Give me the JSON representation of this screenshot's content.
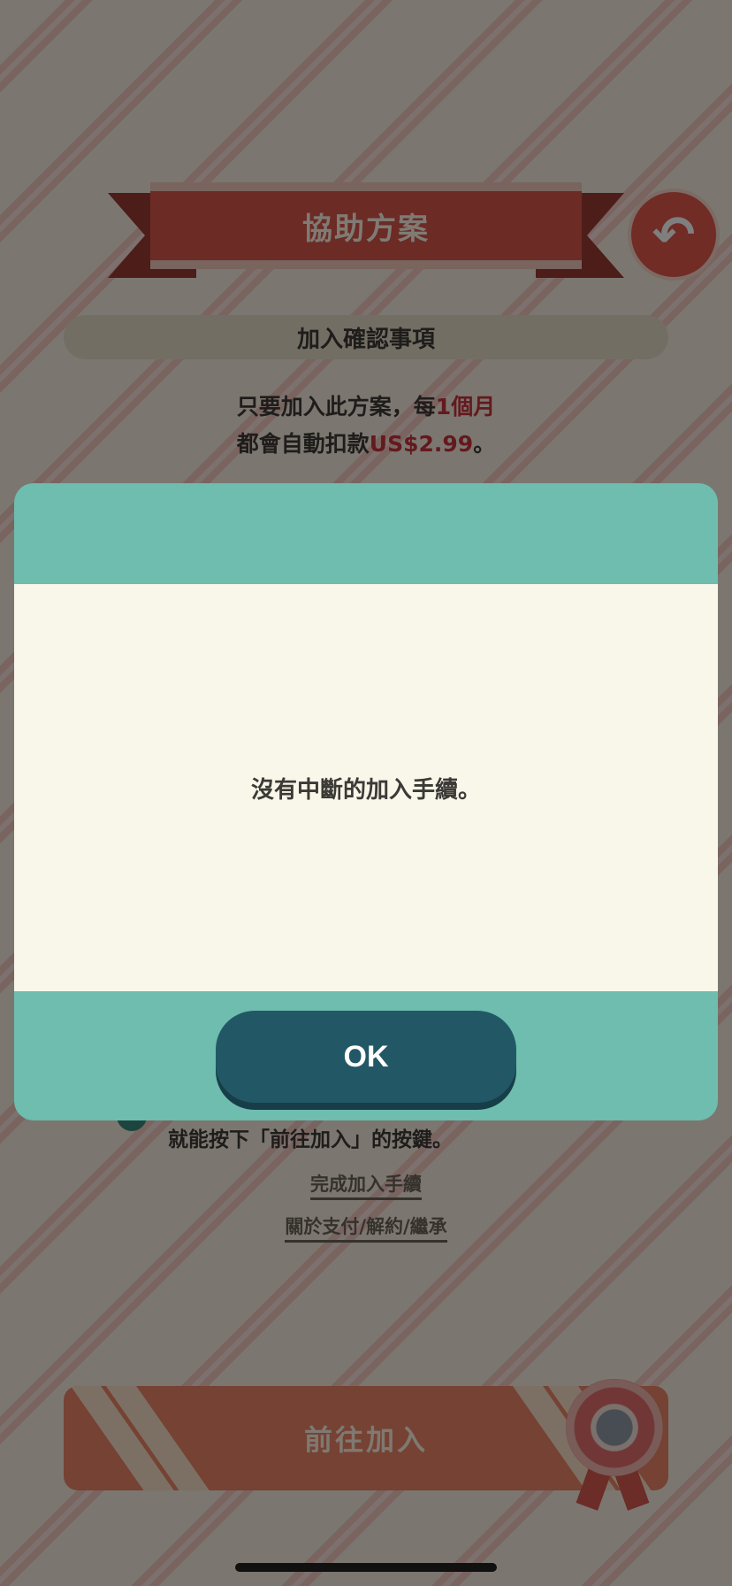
{
  "header": {
    "title": "協助方案",
    "back_icon": "back-arrow-icon"
  },
  "section": {
    "title": "加入確認事項"
  },
  "notice": {
    "line1_prefix": "只要加入此方案，每",
    "line1_highlight": "1個月",
    "line2_prefix": "都會自動扣款",
    "line2_highlight": "US$2.99",
    "line2_suffix": "。"
  },
  "steps": {
    "instruction": "就能按下「前往加入」的按鍵。"
  },
  "links": {
    "complete": "完成加入手續",
    "about": "關於支付/解約/繼承"
  },
  "join_button": {
    "label": "前往加入"
  },
  "modal": {
    "message": "沒有中斷的加入手續。",
    "ok_label": "OK"
  },
  "colors": {
    "accent_red": "#d9574b",
    "modal_teal": "#6ebdae",
    "ok_button": "#225866",
    "highlight": "#c8323d"
  }
}
